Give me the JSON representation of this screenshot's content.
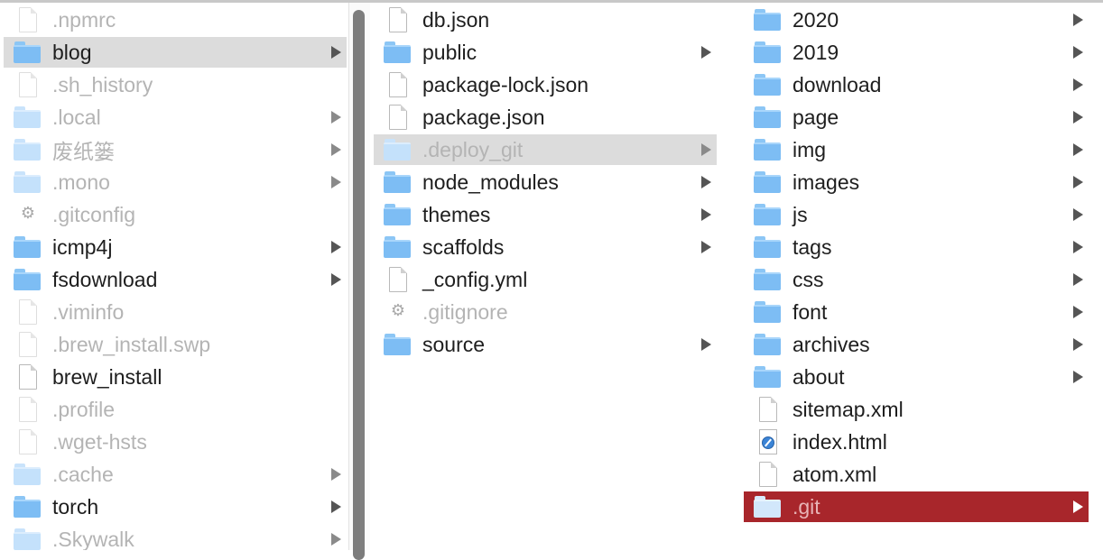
{
  "columns": [
    {
      "items": [
        {
          "name": ".npmrc",
          "icon": "document-icon",
          "dim": true,
          "has_children": false,
          "selected": ""
        },
        {
          "name": "blog",
          "icon": "folder-icon",
          "dim": false,
          "has_children": true,
          "selected": "gray"
        },
        {
          "name": ".sh_history",
          "icon": "document-icon",
          "dim": true,
          "has_children": false,
          "selected": ""
        },
        {
          "name": ".local",
          "icon": "folder-icon",
          "dim": true,
          "has_children": true,
          "selected": ""
        },
        {
          "name": "废纸篓",
          "icon": "folder-icon",
          "dim": true,
          "has_children": true,
          "selected": ""
        },
        {
          "name": ".mono",
          "icon": "folder-icon",
          "dim": true,
          "has_children": true,
          "selected": ""
        },
        {
          "name": ".gitconfig",
          "icon": "gear-icon",
          "dim": true,
          "has_children": false,
          "selected": ""
        },
        {
          "name": "icmp4j",
          "icon": "folder-icon",
          "dim": false,
          "has_children": true,
          "selected": ""
        },
        {
          "name": "fsdownload",
          "icon": "folder-icon",
          "dim": false,
          "has_children": true,
          "selected": ""
        },
        {
          "name": ".viminfo",
          "icon": "document-icon",
          "dim": true,
          "has_children": false,
          "selected": ""
        },
        {
          "name": ".brew_install.swp",
          "icon": "document-icon",
          "dim": true,
          "has_children": false,
          "selected": ""
        },
        {
          "name": "brew_install",
          "icon": "document-icon",
          "dim": false,
          "has_children": false,
          "selected": ""
        },
        {
          "name": ".profile",
          "icon": "document-icon",
          "dim": true,
          "has_children": false,
          "selected": ""
        },
        {
          "name": ".wget-hsts",
          "icon": "document-icon",
          "dim": true,
          "has_children": false,
          "selected": ""
        },
        {
          "name": ".cache",
          "icon": "folder-icon",
          "dim": true,
          "has_children": true,
          "selected": ""
        },
        {
          "name": "torch",
          "icon": "folder-icon",
          "dim": false,
          "has_children": true,
          "selected": ""
        },
        {
          "name": ".Skywalk",
          "icon": "folder-icon",
          "dim": true,
          "has_children": true,
          "selected": ""
        }
      ]
    },
    {
      "items": [
        {
          "name": "db.json",
          "icon": "document-icon",
          "dim": false,
          "has_children": false,
          "selected": ""
        },
        {
          "name": "public",
          "icon": "folder-icon",
          "dim": false,
          "has_children": true,
          "selected": ""
        },
        {
          "name": "package-lock.json",
          "icon": "document-icon",
          "dim": false,
          "has_children": false,
          "selected": ""
        },
        {
          "name": "package.json",
          "icon": "document-icon",
          "dim": false,
          "has_children": false,
          "selected": ""
        },
        {
          "name": ".deploy_git",
          "icon": "folder-icon",
          "dim": true,
          "has_children": true,
          "selected": "gray"
        },
        {
          "name": "node_modules",
          "icon": "folder-icon",
          "dim": false,
          "has_children": true,
          "selected": ""
        },
        {
          "name": "themes",
          "icon": "folder-icon",
          "dim": false,
          "has_children": true,
          "selected": ""
        },
        {
          "name": "scaffolds",
          "icon": "folder-icon",
          "dim": false,
          "has_children": true,
          "selected": ""
        },
        {
          "name": "_config.yml",
          "icon": "document-icon",
          "dim": false,
          "has_children": false,
          "selected": ""
        },
        {
          "name": ".gitignore",
          "icon": "gear-icon",
          "dim": true,
          "has_children": false,
          "selected": ""
        },
        {
          "name": "source",
          "icon": "folder-icon",
          "dim": false,
          "has_children": true,
          "selected": ""
        }
      ]
    },
    {
      "items": [
        {
          "name": "2020",
          "icon": "folder-icon",
          "dim": false,
          "has_children": true,
          "selected": ""
        },
        {
          "name": "2019",
          "icon": "folder-icon",
          "dim": false,
          "has_children": true,
          "selected": ""
        },
        {
          "name": "download",
          "icon": "folder-icon",
          "dim": false,
          "has_children": true,
          "selected": ""
        },
        {
          "name": "page",
          "icon": "folder-icon",
          "dim": false,
          "has_children": true,
          "selected": ""
        },
        {
          "name": "img",
          "icon": "folder-icon",
          "dim": false,
          "has_children": true,
          "selected": ""
        },
        {
          "name": "images",
          "icon": "folder-icon",
          "dim": false,
          "has_children": true,
          "selected": ""
        },
        {
          "name": "js",
          "icon": "folder-icon",
          "dim": false,
          "has_children": true,
          "selected": ""
        },
        {
          "name": "tags",
          "icon": "folder-icon",
          "dim": false,
          "has_children": true,
          "selected": ""
        },
        {
          "name": "css",
          "icon": "folder-icon",
          "dim": false,
          "has_children": true,
          "selected": ""
        },
        {
          "name": "font",
          "icon": "folder-icon",
          "dim": false,
          "has_children": true,
          "selected": ""
        },
        {
          "name": "archives",
          "icon": "folder-icon",
          "dim": false,
          "has_children": true,
          "selected": ""
        },
        {
          "name": "about",
          "icon": "folder-icon",
          "dim": false,
          "has_children": true,
          "selected": ""
        },
        {
          "name": "sitemap.xml",
          "icon": "document-icon",
          "dim": false,
          "has_children": false,
          "selected": ""
        },
        {
          "name": "index.html",
          "icon": "html-document-icon",
          "dim": false,
          "has_children": false,
          "selected": ""
        },
        {
          "name": "atom.xml",
          "icon": "document-icon",
          "dim": false,
          "has_children": false,
          "selected": ""
        },
        {
          "name": ".git",
          "icon": "folder-icon",
          "dim": true,
          "has_children": true,
          "selected": "red"
        }
      ]
    }
  ],
  "colors": {
    "selection_gray": "#dcdcdc",
    "selection_red": "#a8262b",
    "folder_blue": "#7dbdf4",
    "text_dim": "#b4b4b4",
    "text_normal": "#1e1e1e"
  }
}
